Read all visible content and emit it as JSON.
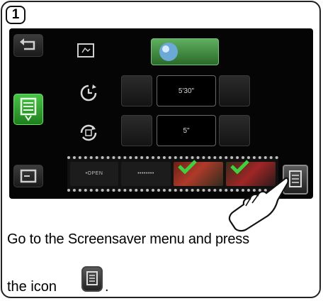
{
  "step": {
    "number": "1"
  },
  "screen": {
    "timer_value": "5'30\"",
    "count_value": "5\"",
    "sidebar_icons": [
      "back-icon",
      "screensaver-menu-icon",
      "exit-icon"
    ],
    "filmstrip_captions": [
      "•OPEN",
      "••••••••"
    ]
  },
  "instructions": {
    "line1": "Go to the Screensaver menu and press",
    "line2": "the icon",
    "line2_end": "."
  },
  "colors": {
    "accent_green": "#49c447",
    "screen_bg": "#050505"
  }
}
